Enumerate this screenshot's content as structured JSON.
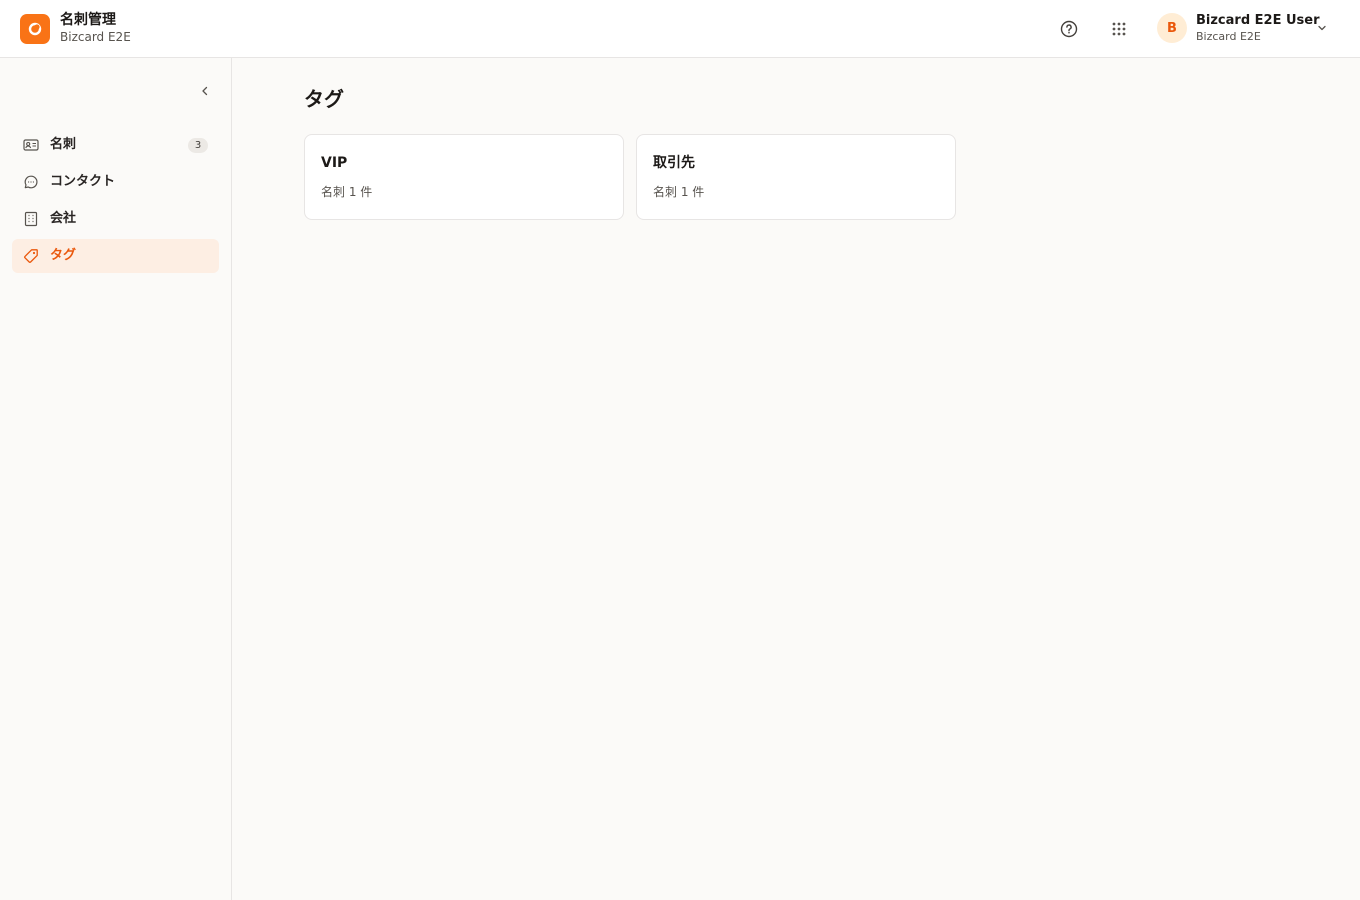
{
  "header": {
    "app_title": "名刺管理",
    "app_subtitle": "Bizcard E2E",
    "brand_color": "#f97316",
    "help_icon": "help-circle-icon",
    "apps_icon": "grid-icon"
  },
  "user": {
    "avatar_initial": "B",
    "name": "Bizcard E2E User",
    "org": "Bizcard E2E"
  },
  "sidebar": {
    "items": [
      {
        "label": "名刺",
        "icon": "id-card-icon",
        "badge": "3",
        "active": false
      },
      {
        "label": "コンタクト",
        "icon": "chat-bubble-icon",
        "active": false
      },
      {
        "label": "会社",
        "icon": "building-icon",
        "active": false
      },
      {
        "label": "タグ",
        "icon": "tag-icon",
        "active": true
      }
    ]
  },
  "main": {
    "title": "タグ",
    "tags": [
      {
        "name": "VIP",
        "count_label": "名刺 1 件"
      },
      {
        "name": "取引先",
        "count_label": "名刺 1 件"
      }
    ]
  }
}
